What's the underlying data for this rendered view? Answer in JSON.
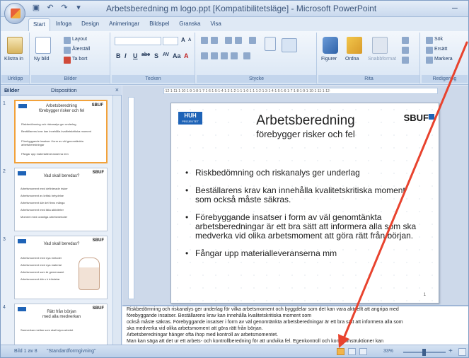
{
  "window": {
    "title": "Arbetsberedning m  logo.ppt [Kompatibilitetsläge] - Microsoft PowerPoint",
    "minimize_icon": "minimize-icon"
  },
  "quick_access": [
    "save-icon",
    "undo-icon",
    "redo-icon",
    "customize-icon"
  ],
  "ribbon": {
    "tabs": [
      "Start",
      "Infoga",
      "Design",
      "Animeringar",
      "Bildspel",
      "Granska",
      "Visa"
    ],
    "active_tab": "Start",
    "groups": {
      "clipboard": {
        "label": "Urklipp",
        "paste": "Klistra in"
      },
      "slides": {
        "label": "Bilder",
        "new_slide": "Ny bild",
        "layout": "Layout",
        "reset": "Återställ",
        "delete": "Ta bort"
      },
      "font": {
        "label": "Tecken",
        "bold": "B",
        "italic": "I",
        "underline": "U",
        "strike": "abe",
        "shadow": "S",
        "spacing": "AV",
        "case": "Aa",
        "color": "A",
        "grow": "A",
        "shrink": "A"
      },
      "paragraph": {
        "label": "Stycke"
      },
      "drawing": {
        "label": "Rita",
        "shapes": "Figurer",
        "arrange": "Ordna",
        "quick_styles": "Snabbformat"
      },
      "editing": {
        "label": "Redigering",
        "find": "Sök",
        "replace": "Ersätt",
        "select": "Markera"
      }
    }
  },
  "left_pane": {
    "tabs": [
      "Bilder",
      "Disposition"
    ],
    "active_tab": "Bilder",
    "close_icon": "close-icon",
    "thumbnails": [
      {
        "num": "1",
        "title": "Arbetsberedning",
        "subtitle": "förebygger risker och fel",
        "logo": "SBUF",
        "bullets": [
          "Riskbedömning och riskanalys ger underlag",
          "Beställarens krav kan innehålla kvalitetskritiska moment",
          "Förebyggande insatser i form av väl genomtänkta arbetsberedningar",
          "Fångar upp materialleveranserna mm"
        ],
        "selected": true
      },
      {
        "num": "2",
        "title": "Vad skall beredas?",
        "subtitle": "",
        "logo": "SBUF",
        "bullets": [
          "Arbetsmoment med definierade risker",
          "Arbetsmoment av kritisk betydelse",
          "Arbetsmoment där det finns många",
          "Arbetsmoment med täta aktiviteter",
          "Moment med ovanliga arbetsmetoder"
        ],
        "selected": false
      },
      {
        "num": "3",
        "title": "Vad skall beredas?",
        "subtitle": "",
        "logo": "SBUF",
        "bullets": [
          "Arbetsmoment med nya metoder",
          "Arbetsmoment med nya material",
          "Arbetsmoment som är gemensamt",
          "Arbetsmoment där s k tröskelar"
        ],
        "selected": false
      },
      {
        "num": "4",
        "title": "Rätt från början",
        "subtitle": "med alla medverkan",
        "logo": "SBUF",
        "bullets": [
          "Samverkan mellan som skall styra arbetet"
        ],
        "selected": false
      }
    ]
  },
  "slide": {
    "huh_logo": "HUH",
    "huh_sub": "PROJEKTET",
    "sbuf_logo": "SBUF",
    "title": "Arbetsberedning",
    "subtitle": "förebygger risker och fel",
    "bullets": [
      "Riskbedömning och riskanalys ger underlag",
      "Beställarens krav kan innehålla kvalitetskritiska moment som också måste säkras.",
      "Förebyggande insatser i form av väl genomtänkta arbetsberedningar är ett bra sätt att informera alla som ska medverka vid olika arbetsmoment att göra rätt från början.",
      "Fångar upp materialleveranserna mm"
    ],
    "page_number": "1"
  },
  "notes": {
    "lines": [
      "Riskbedömning och riskanalys ger underlag för vilka arbetsmoment och byggdelar som det kan vara aktuellt att angripa med",
      "förebyggande insatser. Beställarens krav kan innehålla kvalitetskritiska moment som",
      "också måste säkras. Förebyggande insatser i form av väl genomtänkta arbetsberedningar är ett bra sätt att informera alla som",
      "ska medverka vid olika arbetsmoment att göra rätt från början.",
      "Arbetsberedningar hänger ofta ihop med kontroll av arbetsmomentet.",
      "Man kan säga att det ur ett arbets- och kontrollberedning för att undvika fel. Egenkontroll och kontrollinstruktioner kan"
    ]
  },
  "statusbar": {
    "slide_info": "Bild 1 av 8",
    "theme": "\"Standardformgivning\"",
    "zoom": "33%",
    "plus": "+"
  },
  "annotation": {
    "color": "#e8432e"
  }
}
